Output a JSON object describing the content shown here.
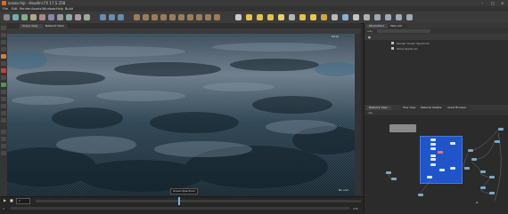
{
  "window": {
    "title": "ocean.hip - Houdini FX 17.5.258",
    "controls": {
      "minimize": "–",
      "maximize": "□",
      "close": "✕"
    }
  },
  "menubar": {
    "items": [
      "File",
      "Edit",
      "Render",
      "Assets",
      "Windows",
      "Help",
      "Build"
    ]
  },
  "viewport": {
    "tabs": [
      "Scene View",
      "Network View"
    ],
    "overlay_label": "Persp",
    "camera_label": "No cam",
    "tooltip": "Ocean Spectrum"
  },
  "parameters": {
    "tabs": [
      "Parameters",
      "Take List"
    ],
    "node_path": "/obj",
    "line1": "Render Ocean Spectrum",
    "line2": "Show Spectrum"
  },
  "network": {
    "tabs": [
      "Network View",
      "Tree View",
      "Material Palette",
      "Asset Browser"
    ],
    "path": "obj"
  },
  "timeline": {
    "frame": "1",
    "start": "1",
    "end": "240",
    "range_end": "240",
    "auto_update": "Auto Update"
  },
  "colors": {
    "accent": "#e06a1b",
    "network_box": "#1f55c9",
    "ocean_dark": "#1a2c38",
    "ocean_light": "#9fb0c2"
  },
  "icons": {
    "play": "play-icon",
    "stop": "stop-icon",
    "home": "home-icon"
  }
}
